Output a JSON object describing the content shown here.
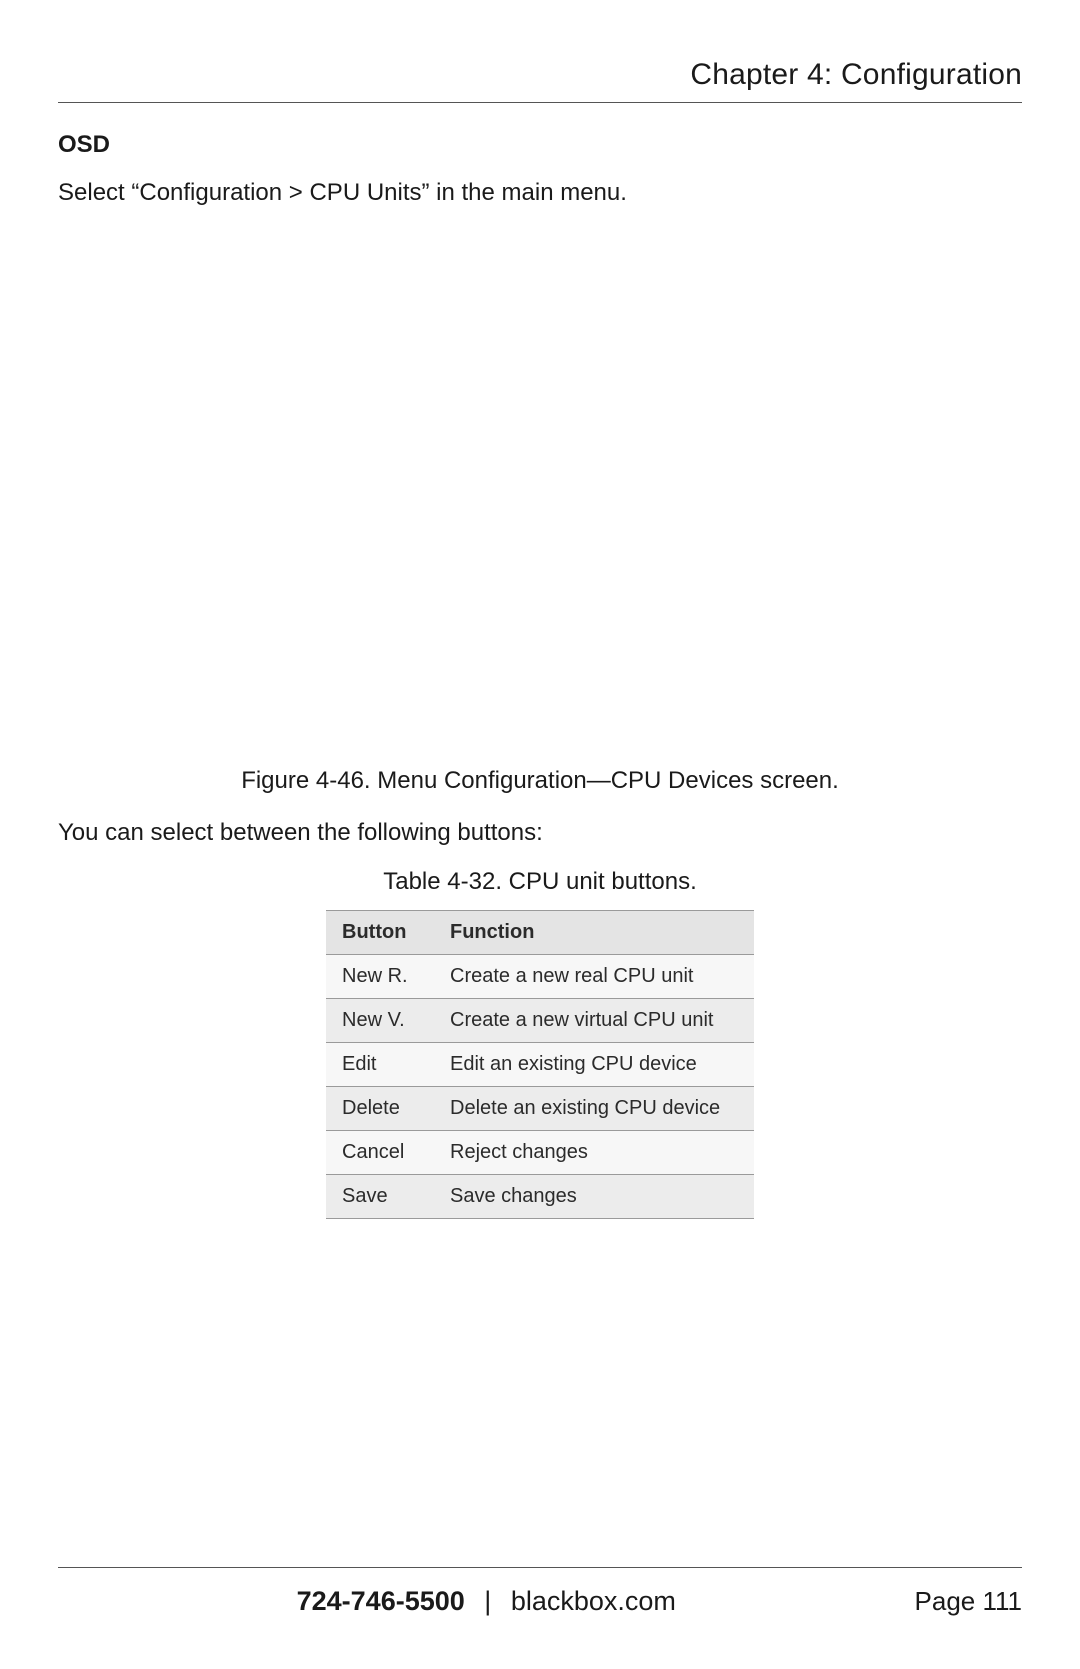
{
  "header": {
    "chapter_title": "Chapter 4: Configuration"
  },
  "section": {
    "heading": "OSD",
    "intro": "Select “Configuration > CPU Units” in the main menu."
  },
  "figure": {
    "caption": "Figure 4-46. Menu Configuration—CPU Devices screen."
  },
  "paragraph": {
    "buttons_intro": "You can select between the following buttons:"
  },
  "table": {
    "caption": "Table 4-32. CPU unit buttons.",
    "headers": {
      "button": "Button",
      "function": "Function"
    },
    "rows": [
      {
        "button": "New R.",
        "function": "Create a new real CPU unit"
      },
      {
        "button": "New V.",
        "function": "Create a new virtual CPU unit"
      },
      {
        "button": "Edit",
        "function": "Edit an existing CPU device"
      },
      {
        "button": "Delete",
        "function": "Delete an existing CPU device"
      },
      {
        "button": "Cancel",
        "function": "Reject changes"
      },
      {
        "button": "Save",
        "function": "Save changes"
      }
    ]
  },
  "footer": {
    "phone": "724-746-5500",
    "separator": "|",
    "site": "blackbox.com",
    "page_label": "Page 111"
  }
}
